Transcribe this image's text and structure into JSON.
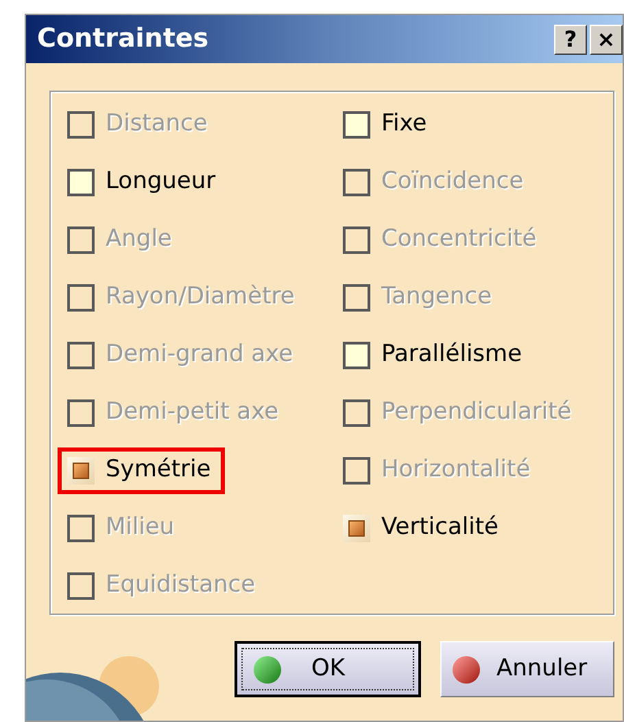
{
  "window": {
    "title": "Contraintes",
    "title_buttons": [
      "?",
      "×"
    ]
  },
  "columns": [
    [
      {
        "label": "Distance",
        "checked": false,
        "disabled": true,
        "highlighted": false
      },
      {
        "label": "Longueur",
        "checked": false,
        "disabled": false,
        "highlighted": false
      },
      {
        "label": "Angle",
        "checked": false,
        "disabled": true,
        "highlighted": false
      },
      {
        "label": "Rayon/Diamètre",
        "checked": false,
        "disabled": true,
        "highlighted": false
      },
      {
        "label": "Demi-grand axe",
        "checked": false,
        "disabled": true,
        "highlighted": false
      },
      {
        "label": "Demi-petit axe",
        "checked": false,
        "disabled": true,
        "highlighted": false
      },
      {
        "label": "Symétrie",
        "checked": true,
        "disabled": false,
        "highlighted": true
      },
      {
        "label": "Milieu",
        "checked": false,
        "disabled": true,
        "highlighted": false
      },
      {
        "label": "Equidistance",
        "checked": false,
        "disabled": true,
        "highlighted": false
      }
    ],
    [
      {
        "label": "Fixe",
        "checked": false,
        "disabled": false,
        "highlighted": false
      },
      {
        "label": "Coïncidence",
        "checked": false,
        "disabled": true,
        "highlighted": false
      },
      {
        "label": "Concentricité",
        "checked": false,
        "disabled": true,
        "highlighted": false
      },
      {
        "label": "Tangence",
        "checked": false,
        "disabled": true,
        "highlighted": false
      },
      {
        "label": "Parallélisme",
        "checked": false,
        "disabled": false,
        "highlighted": false
      },
      {
        "label": "Perpendicularité",
        "checked": false,
        "disabled": true,
        "highlighted": false
      },
      {
        "label": "Horizontalité",
        "checked": false,
        "disabled": true,
        "highlighted": false
      },
      {
        "label": "Verticalité",
        "checked": true,
        "disabled": false,
        "highlighted": false
      }
    ]
  ],
  "buttons": [
    {
      "label": "OK",
      "kind": "ok",
      "focused": true
    },
    {
      "label": "Annuler",
      "kind": "cancel",
      "focused": false
    }
  ]
}
